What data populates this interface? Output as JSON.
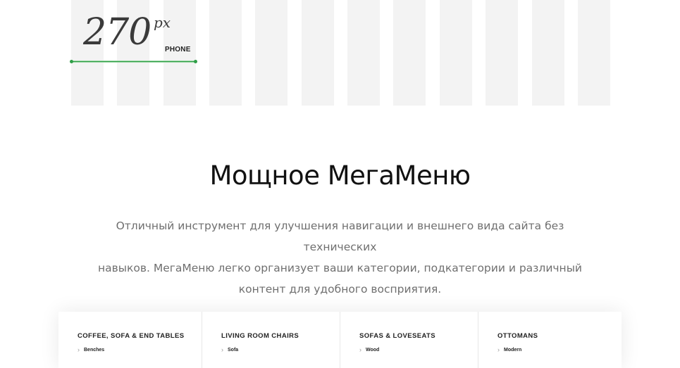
{
  "breakpoint": {
    "width_value": "270",
    "unit": "px",
    "device_label": "PHONE",
    "accent_color": "#2f9e47"
  },
  "section": {
    "title": "Мощное МегаМеню",
    "description_lines": [
      "Отличный инструмент для улучшения навигации и внешнего вида сайта без технических",
      "навыков. МегаМеню легко организует ваши категории, подкатегории и различный",
      "контент для удобного восприятия."
    ]
  },
  "mega_menu": {
    "columns": [
      {
        "heading": "COFFEE, SOFA & END TABLES",
        "items": [
          "Benches"
        ]
      },
      {
        "heading": "LIVING ROOM CHAIRS",
        "items": [
          "Sofa"
        ]
      },
      {
        "heading": "SOFAS & LOVESEATS",
        "items": [
          "Wood"
        ]
      },
      {
        "heading": "OTTOMANS",
        "items": [
          "Modern"
        ]
      }
    ]
  }
}
